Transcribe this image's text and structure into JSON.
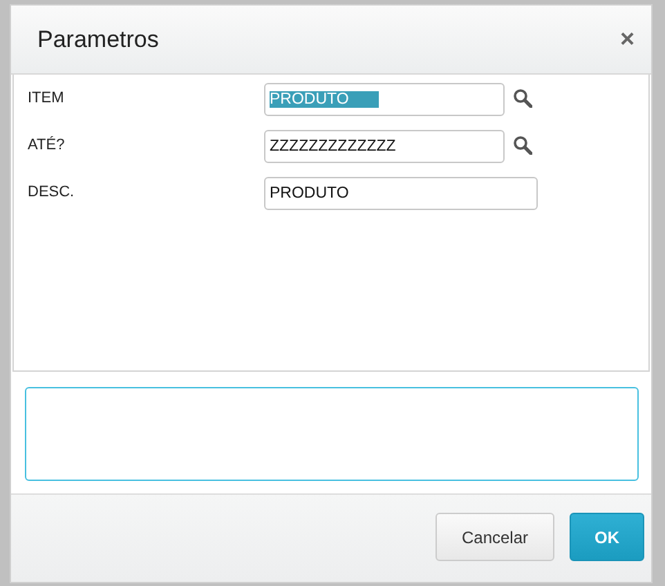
{
  "dialog": {
    "title": "Parametros",
    "close_icon": "×"
  },
  "fields": [
    {
      "label": "ITEM",
      "value": "PRODUTO",
      "kind": "lookup",
      "text_selected": true
    },
    {
      "label": "ATÉ?",
      "value": "ZZZZZZZZZZZZZ",
      "kind": "lookup",
      "text_selected": false
    },
    {
      "label": "DESC.",
      "value": "PRODUTO",
      "kind": "text",
      "text_selected": false
    }
  ],
  "buttons": [
    {
      "label": "Cancelar",
      "primary": false
    },
    {
      "label": "OK",
      "primary": true
    }
  ]
}
